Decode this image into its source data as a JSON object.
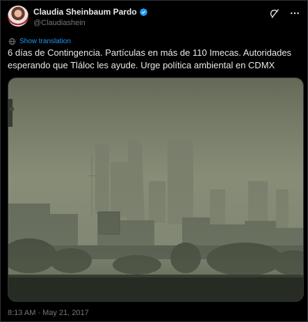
{
  "tweet": {
    "display_name": "Claudia Sheinbaum Pardo",
    "handle": "@Claudiashein",
    "translate_label": "Show translation",
    "text": "6 días de Contingencia. Partículas en más de 110 Imecas. Autoridades esperando que Tláloc les ayude. Urge política ambiental en CDMX",
    "timestamp": "8:13 AM · May 21, 2017"
  },
  "icons": {
    "verified": "verified-badge-icon",
    "grok": "grok-icon",
    "more": "more-options-icon",
    "translate": "translate-globe-icon"
  },
  "colors": {
    "background": "#000000",
    "text_primary": "#e7e9ea",
    "text_secondary": "#71767b",
    "link": "#1d9bf0",
    "border": "#2f3336"
  }
}
